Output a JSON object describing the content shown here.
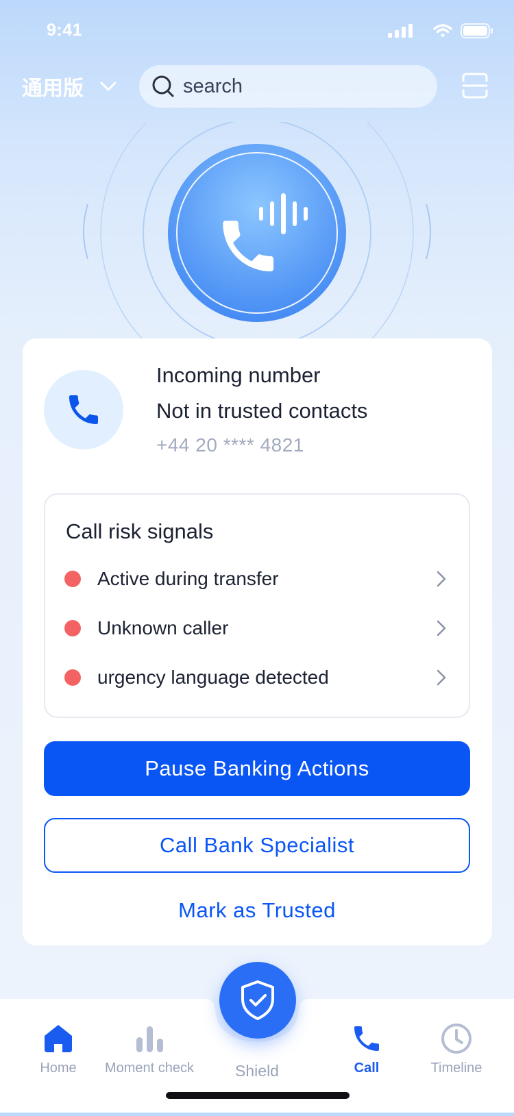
{
  "status_bar": {
    "time": "9:41"
  },
  "header": {
    "edition": "通用版",
    "search_placeholder": "search"
  },
  "caller": {
    "line1": "Incoming number",
    "line2": "Not in trusted contacts",
    "number": "+44 20 **** 4821"
  },
  "risk": {
    "title": "Call risk signals",
    "items": [
      {
        "label": "Active during transfer"
      },
      {
        "label": "Unknown caller"
      },
      {
        "label": "urgency language detected"
      }
    ]
  },
  "actions": {
    "pause": "Pause Banking Actions",
    "call": "Call Bank Specialist",
    "trusted": "Mark as Trusted"
  },
  "tabs": [
    {
      "label": "Home",
      "icon": "home-icon",
      "active": false
    },
    {
      "label": "Moment check",
      "icon": "bar-chart-icon",
      "active": false
    },
    {
      "label": "Shield",
      "icon": "shield-check-icon",
      "active": false
    },
    {
      "label": "Call",
      "icon": "phone-icon",
      "active": true
    },
    {
      "label": "Timeline",
      "icon": "clock-icon",
      "active": false
    }
  ],
  "colors": {
    "primary": "#0a56f5",
    "risk_dot": "#f46363",
    "active_tab": "#1a5cf0",
    "inactive_tab": "#9aa3b8"
  }
}
